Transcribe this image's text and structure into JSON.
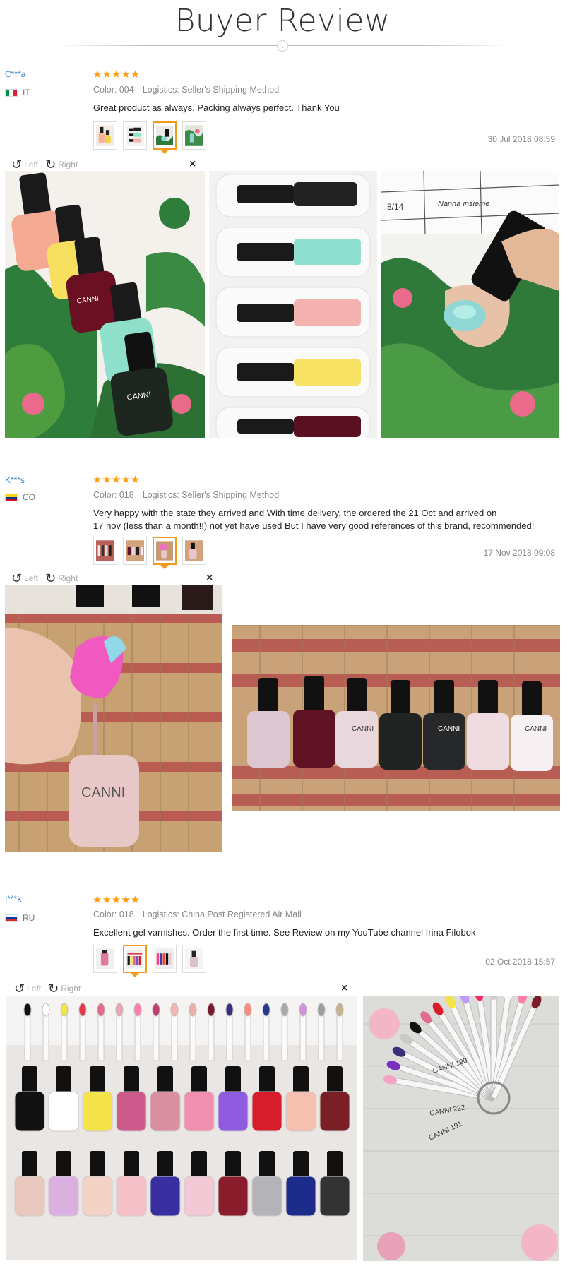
{
  "header": {
    "title": "Buyer Review"
  },
  "viewer": {
    "left_label": "Left",
    "right_label": "Right",
    "close": "×"
  },
  "reviews": [
    {
      "buyer": "C***a",
      "country": "IT",
      "stars": "★★★★★",
      "color": "Color: 004",
      "logistics": "Logistics: Seller's Shipping Method",
      "text": "Great product as always. Packing always perfect. Thank You",
      "date": "30 Jul 2018 08:59"
    },
    {
      "buyer": "K***s",
      "country": "CO",
      "stars": "★★★★★",
      "color": "Color: 018",
      "logistics": "Logistics: Seller's Shipping Method",
      "text_line1": "Very happy with the state they arrived and With time delivery, the ordered the 21 Oct and arrived on",
      "text_line2": "17 nov (less than a month!!) not yet have used But I have very good references of this brand, recommended!",
      "date": "17 Nov 2018 09:08"
    },
    {
      "buyer": "I***k",
      "country": "RU",
      "stars": "★★★★★",
      "color": "Color: 018",
      "logistics": "Logistics: China Post Registered Air Mail",
      "text": "Excellent gel varnishes. Order the first time. See Review on my YouTube channel Irina Filobok",
      "date": "02 Oct 2018 15:57"
    }
  ],
  "photo_text": {
    "brand": "CANNI",
    "note_1": "Nanna insieme",
    "note_2": "8/14",
    "swatch_1": "CANNI 222",
    "swatch_2": "CANNI 191",
    "swatch_3": "CANNI 190"
  },
  "colors": {
    "accent": "#f29b1a",
    "stars": "#ff9e0f",
    "link": "#3b7ecc"
  }
}
